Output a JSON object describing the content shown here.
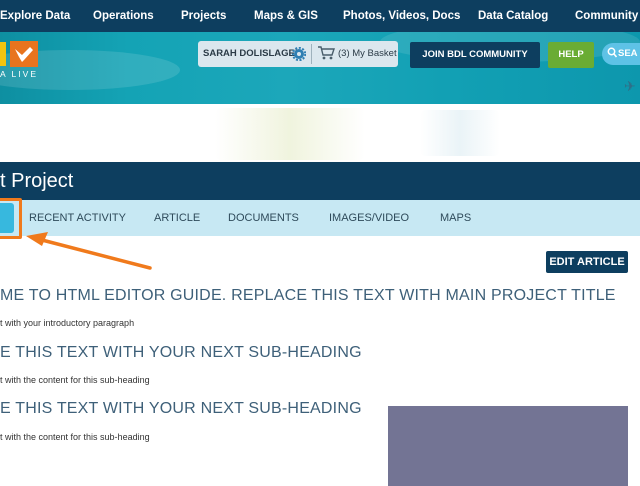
{
  "topnav": {
    "items": [
      "Explore Data",
      "Operations",
      "Projects",
      "Maps & GIS",
      "Photos, Videos, Docs",
      "Data Catalog",
      "Community"
    ]
  },
  "header": {
    "logo_text": "A LIVE",
    "user_name": "SARAH DOLISLAGER",
    "basket_label": "(3) My Basket",
    "join_label": "JOIN BDL COMMUNITY",
    "help_label": "HELP",
    "search_label": "SEA"
  },
  "project": {
    "title": "t Project"
  },
  "tabs": [
    "RECENT ACTIVITY",
    "ARTICLE",
    "DOCUMENTS",
    "IMAGES/VIDEO",
    "MAPS"
  ],
  "content": {
    "edit_label": "EDIT ARTICLE",
    "heading1": "ME TO HTML EDITOR GUIDE. REPLACE THIS TEXT WITH MAIN PROJECT TITLE",
    "para1": "t with your introductory paragraph",
    "heading2": "E THIS TEXT WITH YOUR NEXT SUB-HEADING",
    "para2": "t with the content for this sub-heading",
    "heading3": "E THIS TEXT WITH YOUR NEXT SUB-HEADING",
    "para3": "t with the content for this sub-heading"
  },
  "colors": {
    "navy": "#0d3e5f",
    "tab_bar": "#c7e8f3",
    "active_tab": "#37b8de",
    "highlight_orange": "#f07a1c",
    "help_green": "#6aac34",
    "heading_blue": "#3e6079"
  },
  "icons": [
    "gear-icon",
    "basket-icon",
    "search-icon",
    "bird-icon",
    "arrow-icon"
  ]
}
